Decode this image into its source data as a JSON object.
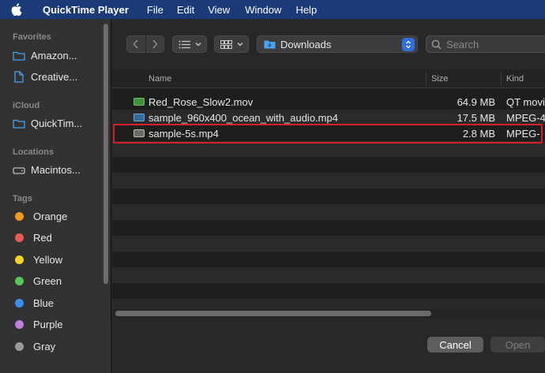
{
  "menubar": {
    "app_name": "QuickTime Player",
    "items": [
      "File",
      "Edit",
      "View",
      "Window",
      "Help"
    ]
  },
  "sidebar": {
    "favorites_label": "Favorites",
    "favorites": [
      {
        "label": "Amazon...",
        "icon": "folder-icon"
      },
      {
        "label": "Creative...",
        "icon": "document-icon"
      }
    ],
    "icloud_label": "iCloud",
    "icloud": [
      {
        "label": "QuickTim...",
        "icon": "folder-icon"
      }
    ],
    "locations_label": "Locations",
    "locations": [
      {
        "label": "Macintos...",
        "icon": "disk-icon"
      }
    ],
    "tags_label": "Tags",
    "tags": [
      {
        "label": "Orange",
        "color": "#f39a1e"
      },
      {
        "label": "Red",
        "color": "#ec5a55"
      },
      {
        "label": "Yellow",
        "color": "#f5d422"
      },
      {
        "label": "Green",
        "color": "#56c75b"
      },
      {
        "label": "Blue",
        "color": "#3b8ff2"
      },
      {
        "label": "Purple",
        "color": "#c27fe0"
      },
      {
        "label": "Gray",
        "color": "#9a9a9e"
      }
    ]
  },
  "toolbar": {
    "location": "Downloads",
    "search_placeholder": "Search"
  },
  "columns": {
    "name": "Name",
    "size": "Size",
    "kind": "Kind"
  },
  "files": [
    {
      "name": "Red_Rose_Slow2.mov",
      "size": "64.9 MB",
      "kind": "QT movi"
    },
    {
      "name": "sample_960x400_ocean_with_audio.mp4",
      "size": "17.5 MB",
      "kind": "MPEG-4"
    },
    {
      "name": "sample-5s.mp4",
      "size": "2.8 MB",
      "kind": "MPEG-"
    }
  ],
  "footer": {
    "cancel_label": "Cancel",
    "open_label": "Open"
  },
  "colors": {
    "menubar": "#1a3a78",
    "highlight_box": "#d81e2a",
    "accent": "#2f6fe0"
  }
}
